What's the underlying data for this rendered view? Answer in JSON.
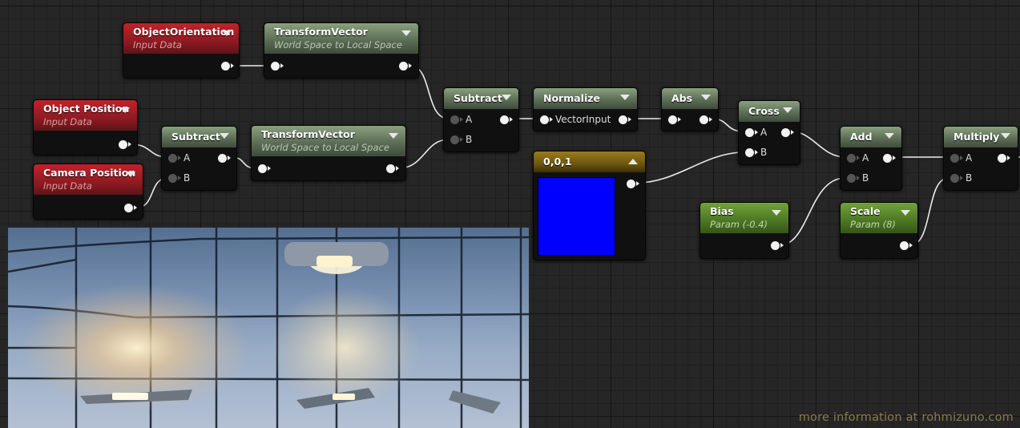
{
  "nodes": {
    "object_orientation": {
      "title": "ObjectOrientation",
      "subtitle": "Input Data"
    },
    "transform_vector_top": {
      "title": "TransformVector",
      "subtitle": "World Space to Local Space"
    },
    "object_position": {
      "title": "Object Position",
      "subtitle": "Input Data"
    },
    "camera_position": {
      "title": "Camera Position",
      "subtitle": "Input Data"
    },
    "subtract_left": {
      "title": "Subtract",
      "pin_a": "A",
      "pin_b": "B"
    },
    "transform_vector_bottom": {
      "title": "TransformVector",
      "subtitle": "World Space to Local Space"
    },
    "subtract_right": {
      "title": "Subtract",
      "pin_a": "A",
      "pin_b": "B"
    },
    "normalize": {
      "title": "Normalize",
      "pin_input": "VectorInput"
    },
    "abs": {
      "title": "Abs"
    },
    "constant": {
      "title": "0,0,1",
      "swatch_color": "#0000ff"
    },
    "cross": {
      "title": "Cross",
      "pin_a": "A",
      "pin_b": "B"
    },
    "add": {
      "title": "Add",
      "pin_a": "A",
      "pin_b": "B"
    },
    "multiply": {
      "title": "Multiply",
      "pin_a": "A",
      "pin_b": "B"
    },
    "bias": {
      "title": "Bias",
      "subtitle": "Param (-0.4)"
    },
    "scale": {
      "title": "Scale",
      "subtitle": "Param (8)"
    }
  },
  "watermark": "more information at rohmizuno.com",
  "colors": {
    "input_header": "#a81e26",
    "function_header": "#5d6e57",
    "param_header": "#4f7a24",
    "constant_header": "#6d560f",
    "constant_value": "#0000ff"
  }
}
